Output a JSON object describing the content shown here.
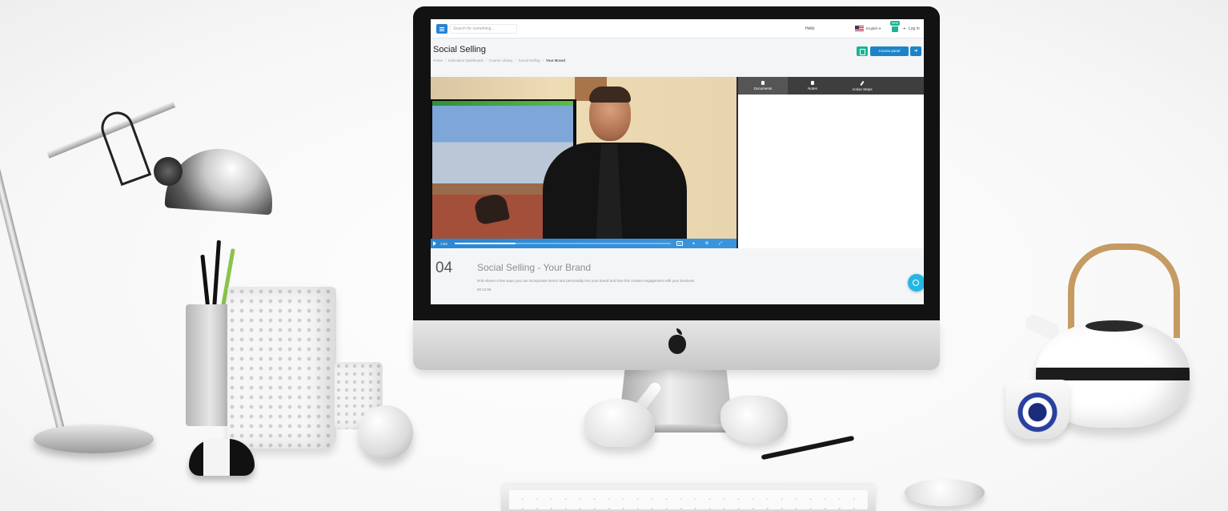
{
  "topbar": {
    "search_placeholder": "Search for something...",
    "greeting": "Hello",
    "language": "English",
    "new_badge": "NEW",
    "login": "Log in"
  },
  "page": {
    "title": "Social Selling",
    "breadcrumb": [
      "Home",
      "Education Dashboard",
      "Course Library",
      "Social Selling",
      "Your Brand"
    ],
    "course_panel_label": "Course panel"
  },
  "video": {
    "current_time": "1:04",
    "progress": 0.28
  },
  "side_panel": {
    "tabs": [
      {
        "label": "Documents",
        "icon": "document-icon"
      },
      {
        "label": "Notes",
        "icon": "note-icon"
      },
      {
        "label": "Action Steps",
        "icon": "pencil-icon"
      }
    ]
  },
  "lesson": {
    "number": "04",
    "title": "Social Selling - Your Brand",
    "description": "Rob shares a few ways you can incorporate humor and personality into your brand and how this creates engagement with your business",
    "duration": "00:12:55"
  },
  "colors": {
    "primary": "#1c84c6",
    "success": "#1ab394",
    "video_bar": "#2a87d4",
    "fab": "#23b7e5"
  }
}
